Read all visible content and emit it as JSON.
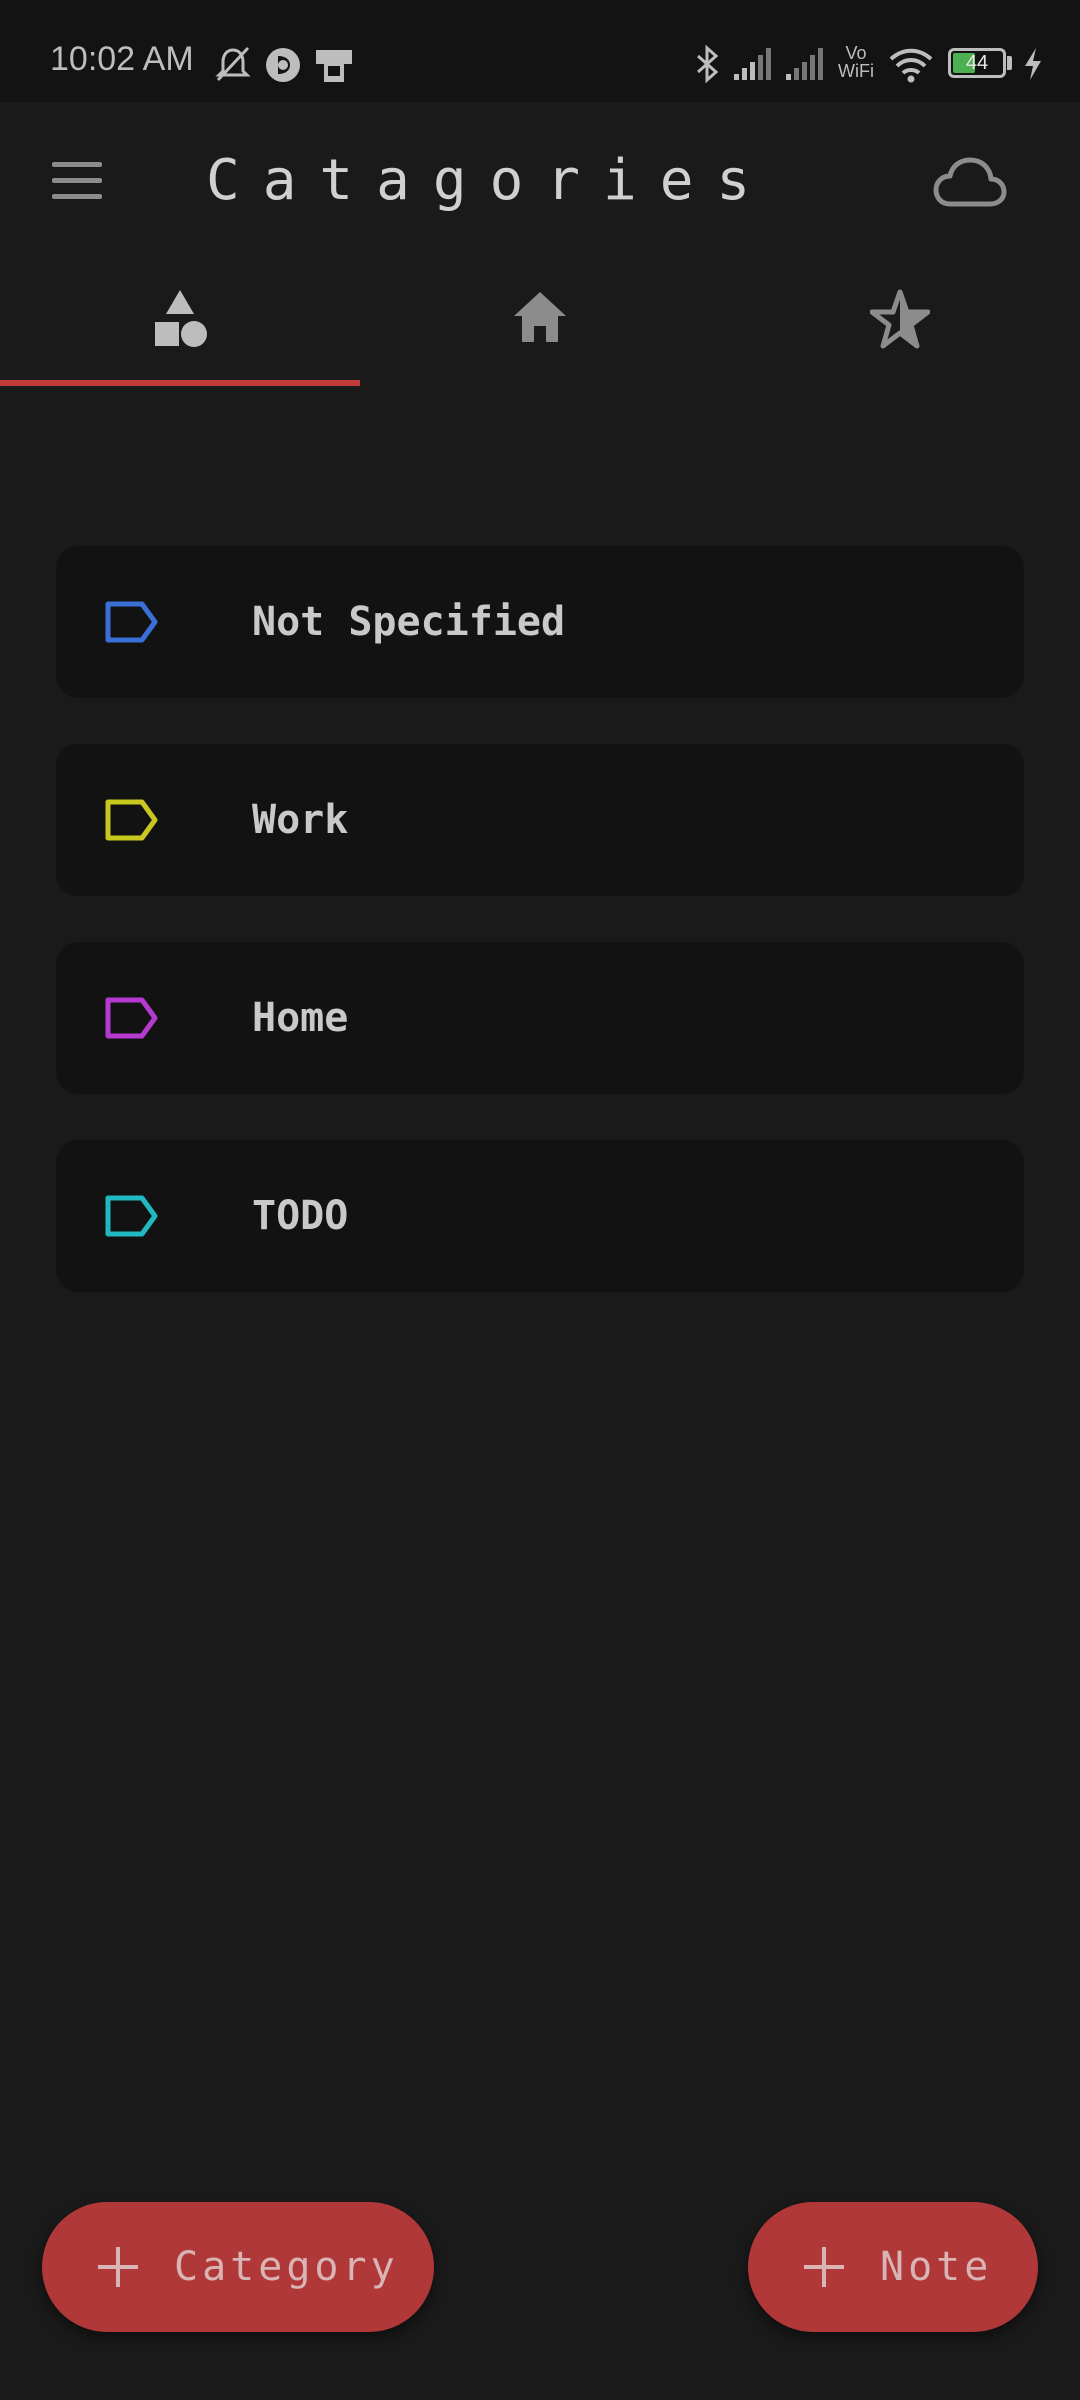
{
  "status_bar": {
    "time": "10:02 AM",
    "battery_level": "44",
    "vowifi_top": "Vo",
    "vowifi_bottom": "WiFi",
    "icons": [
      "mute-icon",
      "app-notification-icon",
      "sim-toolkit-icon",
      "bluetooth-icon",
      "signal-icon",
      "signal-icon",
      "wifi-icon",
      "battery-icon",
      "charging-icon"
    ]
  },
  "app_bar": {
    "title": "Catagories",
    "menu_icon": "menu-icon",
    "cloud_icon": "cloud-icon"
  },
  "tabs": [
    {
      "icon": "shapes-icon",
      "selected": true
    },
    {
      "icon": "home-icon",
      "selected": false
    },
    {
      "icon": "star-icon",
      "selected": false
    }
  ],
  "categories": [
    {
      "label": "Not Specified",
      "color": "#3a6fd8"
    },
    {
      "label": "Work",
      "color": "#c8c81e"
    },
    {
      "label": "Home",
      "color": "#b63ad0"
    },
    {
      "label": "TODO",
      "color": "#22b8c2"
    }
  ],
  "fabs": {
    "category_label": "Category",
    "note_label": "Note"
  },
  "colors": {
    "accent": "#b13838",
    "background": "#1a1a1a",
    "card": "#121212"
  }
}
